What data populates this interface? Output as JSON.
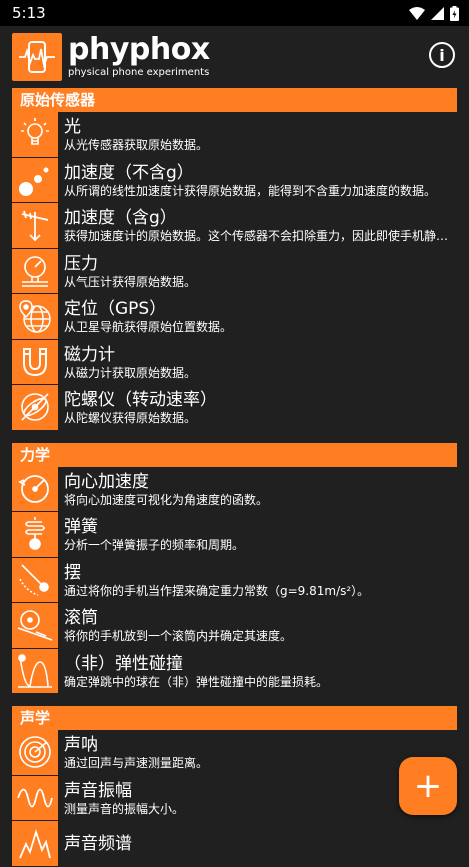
{
  "status": {
    "time": "5:13"
  },
  "app": {
    "name": "phyphox",
    "tagline": "physical phone experiments"
  },
  "categories": [
    {
      "title": "原始传感器",
      "items": [
        {
          "title": "光",
          "desc": "从光传感器获取原始数据。",
          "icon": "light-bulb-icon"
        },
        {
          "title": "加速度（不含g）",
          "desc": "从所谓的线性加速度计获得原始数据，能得到不含重力加速度的数据。",
          "icon": "acceleration-icon"
        },
        {
          "title": "加速度（含g）",
          "desc": "获得加速度计的原始数据。这个传感器不会扣除重力，因此即使手机静止也会有读数。",
          "icon": "acceleration-g-icon"
        },
        {
          "title": "压力",
          "desc": "从气压计获得原始数据。",
          "icon": "pressure-gauge-icon"
        },
        {
          "title": "定位（GPS）",
          "desc": "从卫星导航获得原始位置数据。",
          "icon": "location-globe-icon"
        },
        {
          "title": "磁力计",
          "desc": "从磁力计获取原始数据。",
          "icon": "magnet-icon"
        },
        {
          "title": "陀螺仪（转动速率）",
          "desc": "从陀螺仪获得原始数据。",
          "icon": "gyroscope-icon"
        }
      ]
    },
    {
      "title": "力学",
      "items": [
        {
          "title": "向心加速度",
          "desc": "将向心加速度可视化为角速度的函数。",
          "icon": "centripetal-icon"
        },
        {
          "title": "弹簧",
          "desc": "分析一个弹簧振子的频率和周期。",
          "icon": "spring-icon"
        },
        {
          "title": "摆",
          "desc": "通过将你的手机当作摆来确定重力常数（g=9.81m/s²）。",
          "icon": "pendulum-icon"
        },
        {
          "title": "滚筒",
          "desc": "将你的手机放到一个滚筒内并确定其速度。",
          "icon": "roll-icon"
        },
        {
          "title": "（非）弹性碰撞",
          "desc": "确定弹跳中的球在（非）弹性碰撞中的能量损耗。",
          "icon": "collision-icon"
        }
      ]
    },
    {
      "title": "声学",
      "items": [
        {
          "title": "声呐",
          "desc": "通过回声与声速测量距离。",
          "icon": "sonar-icon"
        },
        {
          "title": "声音振幅",
          "desc": "测量声音的振幅大小。",
          "icon": "sine-wave-icon"
        },
        {
          "title": "声音频谱",
          "desc": "",
          "icon": "spectrum-icon"
        }
      ]
    }
  ],
  "fab": {
    "label": "+"
  },
  "colors": {
    "accent": "#ff7e22",
    "background": "#202020"
  }
}
